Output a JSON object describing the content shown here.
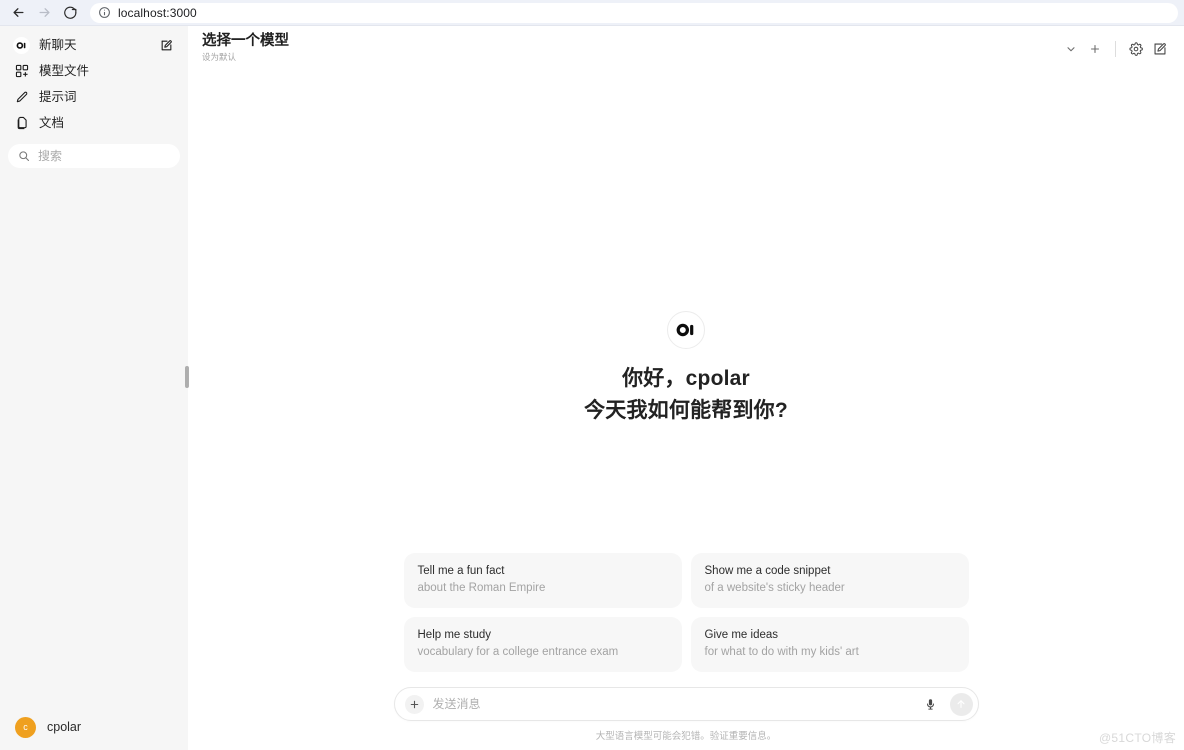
{
  "browser": {
    "back_label": "后退",
    "forward_label": "前进",
    "reload_label": "重新加载",
    "url": "localhost:3000"
  },
  "sidebar": {
    "new_chat": {
      "label": "新聊天",
      "icon": "open-webui-logo",
      "trailing_icon": "edit-square-icon"
    },
    "items": [
      {
        "label": "模型文件",
        "icon": "boxes-icon"
      },
      {
        "label": "提示词",
        "icon": "pencil-icon"
      },
      {
        "label": "文档",
        "icon": "documents-icon"
      }
    ],
    "search": {
      "placeholder": "搜索",
      "icon": "search-icon"
    },
    "user": {
      "name": "cpolar",
      "avatar_initial": "c",
      "avatar_color": "#efa01f"
    }
  },
  "header": {
    "model_title": "选择一个模型",
    "model_subtitle": "设为默认",
    "actions": [
      {
        "name": "chevron-down-icon",
        "label": "展开模型列表"
      },
      {
        "name": "plus-icon",
        "label": "添加模型"
      },
      {
        "name": "gear-icon",
        "label": "设置"
      },
      {
        "name": "edit-square-icon",
        "label": "新对话"
      }
    ]
  },
  "main": {
    "logo": "OI",
    "greeting_line1": "你好，cpolar",
    "greeting_line2": "今天我如何能帮到你?",
    "suggestions": [
      {
        "title": "Tell me a fun fact",
        "subtitle": "about the Roman Empire"
      },
      {
        "title": "Show me a code snippet",
        "subtitle": "of a website's sticky header"
      },
      {
        "title": "Help me study",
        "subtitle": "vocabulary for a college entrance exam"
      },
      {
        "title": "Give me ideas",
        "subtitle": "for what to do with my kids' art"
      }
    ],
    "composer": {
      "placeholder": "发送消息",
      "value": "",
      "plus_icon": "plus-icon",
      "mic_icon": "microphone-icon",
      "send_icon": "arrow-up-icon"
    },
    "disclaimer": "大型语言模型可能会犯错。验证重要信息。"
  },
  "watermark": "@51CTO博客",
  "colors": {
    "sidebar_bg": "#f6f6f6",
    "card_bg": "#f7f7f7",
    "accent": "#efa01f",
    "browser_bar": "#eef1f8"
  }
}
